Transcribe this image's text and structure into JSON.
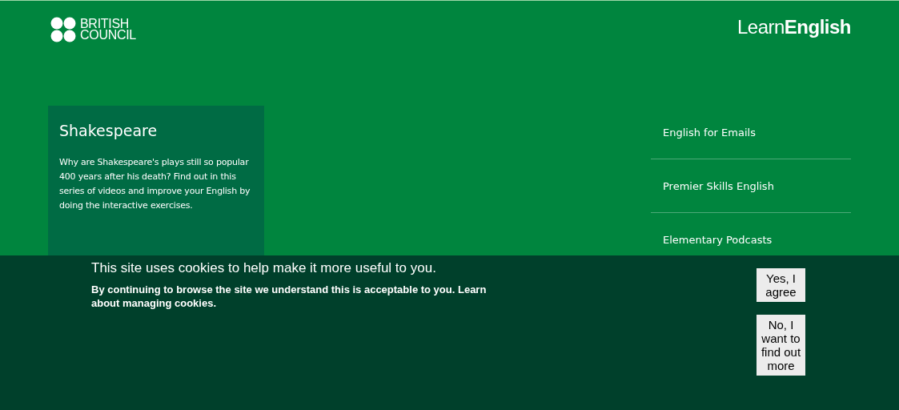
{
  "header": {
    "logo": {
      "line_1": "BRITISH",
      "line_2": "COUNCIL"
    },
    "site_title": "Learn**English**"
  },
  "feature_card": {
    "title": "Shakespeare",
    "description": "Why are Shakespeare's plays still so popular 400 years after his death? Find out in this series of videos and improve your English by doing the interactive exercises."
  },
  "side_links": [
    "English for Emails",
    "Premier Skills English",
    "Elementary Podcasts"
  ],
  "cookie_banner": {
    "heading": "This site uses cookies to help make it more useful to you.",
    "message": "By continuing to browse the site we understand this is acceptable to you. Learn about managing cookies.",
    "buttons": [
      "Yes, I agree",
      "No, I want to find out more"
    ]
  }
}
